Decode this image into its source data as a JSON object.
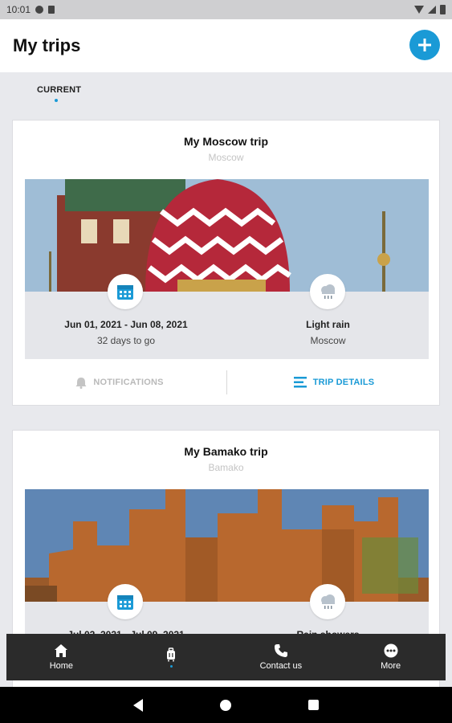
{
  "status_bar": {
    "time": "10:01"
  },
  "header": {
    "title": "My trips"
  },
  "tabs": [
    {
      "label": "CURRENT"
    }
  ],
  "trips": [
    {
      "title": "My Moscow trip",
      "city": "Moscow",
      "dates": "Jun 01, 2021 - Jun 08, 2021",
      "countdown": "32 days to go",
      "weather": "Light rain",
      "weather_city": "Moscow",
      "notifications_label": "NOTIFICATIONS",
      "details_label": "TRIP DETAILS"
    },
    {
      "title": "My Bamako trip",
      "city": "Bamako",
      "dates": "Jul 02, 2021 - Jul 09, 2021",
      "weather": "Rain showers"
    }
  ],
  "bottom_nav": [
    {
      "label": "Home",
      "icon": "home-icon"
    },
    {
      "label": "",
      "icon": "luggage-icon",
      "active": true
    },
    {
      "label": "Contact us",
      "icon": "phone-icon"
    },
    {
      "label": "More",
      "icon": "more-icon"
    }
  ],
  "colors": {
    "accent": "#1a9ad6",
    "nav_bg": "#2b2b2b",
    "info_bg": "#e5e6ea"
  }
}
